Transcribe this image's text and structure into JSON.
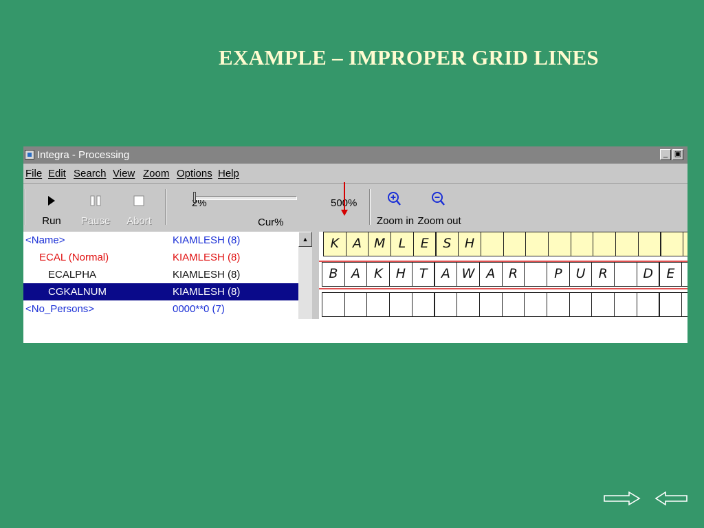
{
  "slide": {
    "title": "EXAMPLE – IMPROPER GRID LINES"
  },
  "window": {
    "title": "Integra - Processing",
    "minimize_label": "_",
    "maximize_label": "▣"
  },
  "menu": [
    "File",
    "Edit",
    "Search",
    "View",
    "Zoom",
    "Options",
    "Help"
  ],
  "toolbar": {
    "run": "Run",
    "pause": "Pause",
    "abort": "Abort",
    "zoom_min": "2%",
    "zoom_max": "500%",
    "zoom_current_label": "Cur%",
    "zoom_in": "Zoom in",
    "zoom_out": "Zoom out"
  },
  "tree": [
    {
      "name": "<Name>",
      "value": "KIAMLESH (8)",
      "color": "#1a2fd6",
      "indent": 0,
      "selected": false
    },
    {
      "name": "ECAL (Normal)",
      "value": "KIAMLESH (8)",
      "color": "#e01010",
      "indent": 1,
      "selected": false
    },
    {
      "name": "ECALPHA",
      "value": "KIAMLESH (8)",
      "color": "#101010",
      "indent": 2,
      "selected": false
    },
    {
      "name": "CGKALNUM",
      "value": "KIAMLESH (8)",
      "color": "#ffffff",
      "indent": 2,
      "selected": true
    },
    {
      "name": "<No_Persons>",
      "value": "0000**0 (7)",
      "color": "#1a2fd6",
      "indent": 0,
      "selected": false
    }
  ],
  "grid": {
    "row1": [
      "K",
      "A",
      "M",
      "L",
      "E",
      "S",
      "H",
      "",
      "",
      "",
      "",
      "",
      "",
      "",
      "",
      "",
      ""
    ],
    "row2": [
      "B",
      "A",
      "K",
      "H",
      "T",
      "A",
      "W",
      "A",
      "R",
      "",
      "P",
      "U",
      "R",
      "",
      "D",
      "E",
      ""
    ],
    "row3": [
      "",
      "",
      "",
      "",
      "",
      "",
      "",
      "",
      "",
      "",
      "",
      "",
      "",
      "",
      "",
      "",
      ""
    ]
  },
  "colors": {
    "slide_bg": "#35976a",
    "title": "#fffbd0",
    "annotation_arrow": "#d40000",
    "selection": "#0a0a8a"
  },
  "nav": {
    "next": "right-arrow-icon",
    "previous": "left-arrow-icon"
  }
}
